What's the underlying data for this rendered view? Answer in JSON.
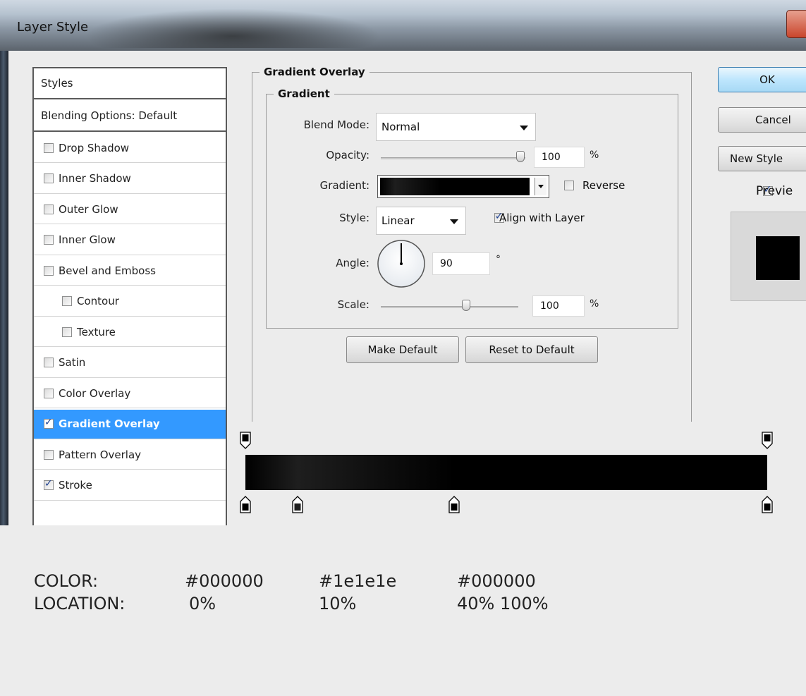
{
  "window": {
    "title": "Layer Style"
  },
  "styles_panel": {
    "header": "Styles",
    "blending": "Blending Options: Default",
    "items": [
      {
        "label": "Drop Shadow",
        "checked": false
      },
      {
        "label": "Inner Shadow",
        "checked": false
      },
      {
        "label": "Outer Glow",
        "checked": false
      },
      {
        "label": "Inner Glow",
        "checked": false
      },
      {
        "label": "Bevel and Emboss",
        "checked": false
      },
      {
        "label": "Contour",
        "checked": false
      },
      {
        "label": "Texture",
        "checked": false
      },
      {
        "label": "Satin",
        "checked": false
      },
      {
        "label": "Color Overlay",
        "checked": false
      },
      {
        "label": "Gradient Overlay",
        "checked": true
      },
      {
        "label": "Pattern Overlay",
        "checked": false
      },
      {
        "label": "Stroke",
        "checked": true
      }
    ]
  },
  "gradient_overlay": {
    "title": "Gradient Overlay",
    "group_title": "Gradient",
    "blend_mode_label": "Blend Mode:",
    "blend_mode_value": "Normal",
    "opacity_label": "Opacity:",
    "opacity_value": "100",
    "opacity_unit": "%",
    "gradient_label": "Gradient:",
    "reverse_label": "Reverse",
    "reverse_checked": false,
    "style_label": "Style:",
    "style_value": "Linear",
    "align_label": "Align with Layer",
    "align_checked": true,
    "angle_label": "Angle:",
    "angle_value": "90",
    "angle_unit": "°",
    "scale_label": "Scale:",
    "scale_value": "100",
    "scale_unit": "%",
    "make_default": "Make Default",
    "reset_default": "Reset to Default"
  },
  "buttons": {
    "ok": "OK",
    "cancel": "Cancel",
    "new_style": "New Style",
    "preview": "Previe",
    "preview_checked": true
  },
  "gradient_editor": {
    "stops": [
      {
        "color": "#000000",
        "location": 0
      },
      {
        "color": "#1e1e1e",
        "location": 10
      },
      {
        "color": "#000000",
        "location": 40
      },
      {
        "color": "#000000",
        "location": 100
      }
    ]
  },
  "annotation": {
    "color_label": "COLOR:",
    "location_label": "LOCATION:",
    "color_1": "#000000",
    "color_2": "#1e1e1e",
    "color_3": "#000000",
    "location_1": "0%",
    "location_2": "10%",
    "location_3": "40% 100%"
  }
}
